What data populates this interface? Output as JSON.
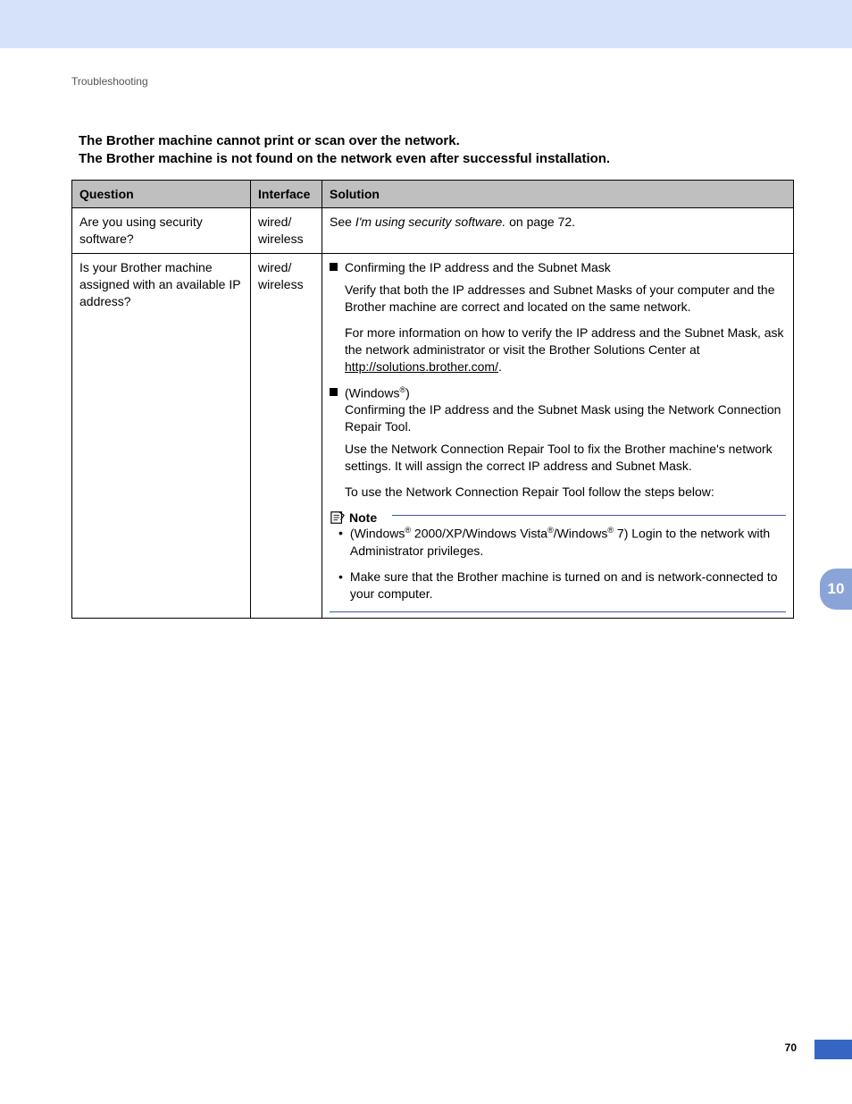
{
  "breadcrumb": "Troubleshooting",
  "title_line1": "The Brother machine cannot print or scan over the network.",
  "title_line2": "The Brother machine is not found on the network even after successful installation.",
  "headers": {
    "q": "Question",
    "i": "Interface",
    "s": "Solution"
  },
  "row1": {
    "question": "Are you using security software?",
    "interface": "wired/ wireless",
    "sol_prefix": "See ",
    "sol_link": "I'm using security software.",
    "sol_suffix": " on page 72."
  },
  "row2": {
    "question": "Is your Brother machine assigned with an available IP address?",
    "interface": "wired/ wireless",
    "b1_head": "Confirming the IP address and the Subnet Mask",
    "b1_p1": "Verify that both the IP addresses and Subnet Masks of your computer and the Brother machine are correct and located on the same network.",
    "b1_p2a": "For more information on how to verify the IP address and the Subnet Mask, ask the network administrator or visit the Brother Solutions Center at ",
    "b1_link": "http://solutions.brother.com/",
    "b1_p2b": ".",
    "b2_head_pre": "(Windows",
    "b2_head_post": ")",
    "b2_sub": "Confirming the IP address and the Subnet Mask using the Network Connection Repair Tool.",
    "b2_p1": "Use the Network Connection Repair Tool to fix the Brother machine's network settings. It will assign the correct IP address and Subnet Mask.",
    "b2_p2": "To use the Network Connection Repair Tool follow the steps below:",
    "note_label": "Note",
    "note1_a": "(Windows",
    "note1_b": " 2000/XP/Windows Vista",
    "note1_c": "/Windows",
    "note1_d": " 7) Login to the network with Administrator privileges.",
    "note2": "Make sure that the Brother machine is turned on and is network-connected to your computer."
  },
  "reg": "®",
  "tab": "10",
  "page": "70"
}
